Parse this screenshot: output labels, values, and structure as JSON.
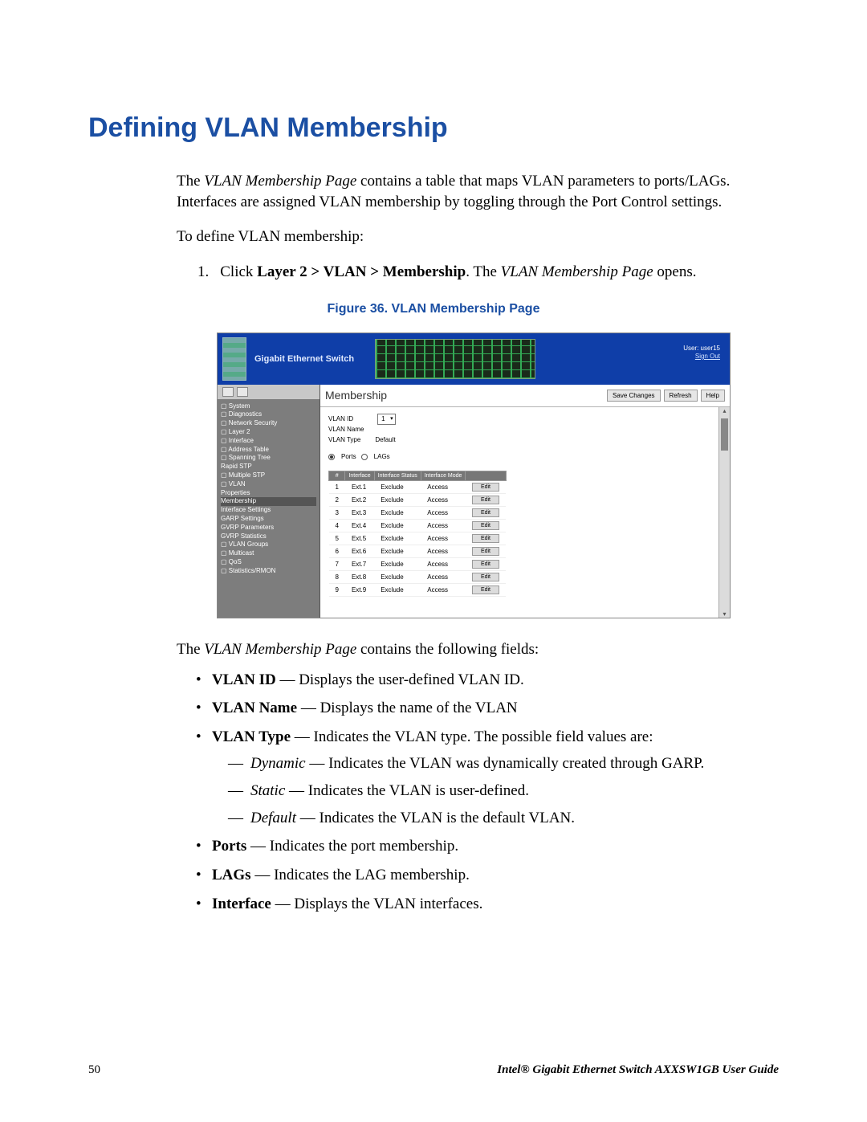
{
  "heading": "Defining VLAN Membership",
  "intro_pre": "The ",
  "intro_em": "VLAN Membership Page",
  "intro_post": " contains a table that maps VLAN parameters to ports/LAGs. Interfaces are assigned VLAN membership by toggling through the Port Control settings.",
  "define_line": "To define VLAN membership:",
  "step_num": "1.",
  "step_click": "Click ",
  "step_path": "Layer 2 > VLAN > Membership",
  "step_mid": ". The ",
  "step_page": "VLAN Membership Page",
  "step_end": " opens.",
  "figcaption": "Figure 36. VLAN Membership Page",
  "scr": {
    "product": "Gigabit Ethernet Switch",
    "user_label": "User: user15",
    "signout": "Sign Out",
    "nav": [
      "▢ System",
      "▢ Diagnostics",
      "▢ Network Security",
      "▢ Layer 2",
      "   ▢ Interface",
      "   ▢ Address Table",
      "   ▢ Spanning Tree",
      "      Rapid STP",
      "   ▢ Multiple STP",
      "   ▢ VLAN",
      "      Properties",
      "      Membership",
      "      Interface Settings",
      "      GARP Settings",
      "      GVRP Parameters",
      "      GVRP Statistics",
      "   ▢ VLAN Groups",
      "▢ Multicast",
      "▢ QoS",
      "▢ Statistics/RMON"
    ],
    "nav_selected_index": 11,
    "main_title": "Membership",
    "buttons": {
      "save": "Save Changes",
      "refresh": "Refresh",
      "help": "Help"
    },
    "fields": {
      "vlan_id_label": "VLAN ID",
      "vlan_id_value": "1",
      "vlan_name_label": "VLAN Name",
      "vlan_name_value": "",
      "vlan_type_label": "VLAN Type",
      "vlan_type_value": "Default",
      "radio_ports": "Ports",
      "radio_lags": "LAGs"
    },
    "cols": [
      "#",
      "Interface",
      "Interface Status",
      "Interface Mode",
      ""
    ],
    "rows": [
      {
        "n": "1",
        "if": "Ext.1",
        "st": "Exclude",
        "mode": "Access"
      },
      {
        "n": "2",
        "if": "Ext.2",
        "st": "Exclude",
        "mode": "Access"
      },
      {
        "n": "3",
        "if": "Ext.3",
        "st": "Exclude",
        "mode": "Access"
      },
      {
        "n": "4",
        "if": "Ext.4",
        "st": "Exclude",
        "mode": "Access"
      },
      {
        "n": "5",
        "if": "Ext.5",
        "st": "Exclude",
        "mode": "Access"
      },
      {
        "n": "6",
        "if": "Ext.6",
        "st": "Exclude",
        "mode": "Access"
      },
      {
        "n": "7",
        "if": "Ext.7",
        "st": "Exclude",
        "mode": "Access"
      },
      {
        "n": "8",
        "if": "Ext.8",
        "st": "Exclude",
        "mode": "Access"
      },
      {
        "n": "9",
        "if": "Ext.9",
        "st": "Exclude",
        "mode": "Access"
      }
    ],
    "edit_label": "Edit"
  },
  "fields_intro_pre": "The ",
  "fields_intro_em": "VLAN Membership Page",
  "fields_intro_post": " contains the following fields:",
  "fields": [
    {
      "term": "VLAN ID",
      "desc": " — Displays the user-defined VLAN ID."
    },
    {
      "term": "VLAN Name",
      "desc": " — Displays the name of the VLAN"
    },
    {
      "term": "VLAN Type",
      "desc": " — Indicates the VLAN type. The possible field values are:",
      "sub": [
        {
          "em": "Dynamic",
          "desc": " — Indicates the VLAN was dynamically created through GARP."
        },
        {
          "em": "Static",
          "desc": " — Indicates the VLAN is user-defined."
        },
        {
          "em": "Default",
          "desc": " — Indicates the VLAN is the default VLAN."
        }
      ]
    },
    {
      "term": "Ports",
      "desc": " — Indicates the port membership."
    },
    {
      "term": "LAGs",
      "desc": " — Indicates the LAG membership."
    },
    {
      "term": "Interface",
      "desc": " — Displays the VLAN interfaces."
    }
  ],
  "footer": {
    "page": "50",
    "guide": "Intel® Gigabit Ethernet Switch AXXSW1GB User Guide"
  }
}
